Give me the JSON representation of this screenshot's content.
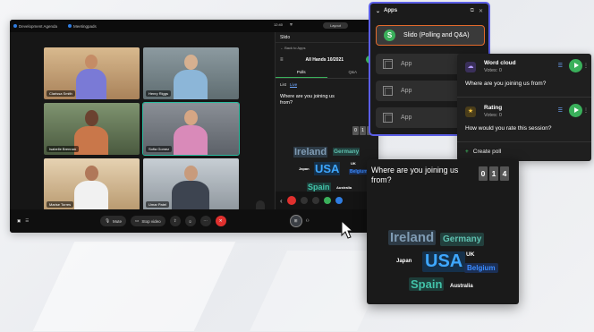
{
  "window_title_items": [
    "Development Agenda",
    "Meetingpads"
  ],
  "status_time": "12:40",
  "status_pill": "Layout",
  "participants": [
    {
      "name": "Clarissa Smith"
    },
    {
      "name": "Henry Riggs"
    },
    {
      "name": "Isabelle Brennan"
    },
    {
      "name": "Sofia Gomez"
    },
    {
      "name": "Marise Torres"
    },
    {
      "name": "Umar Patel"
    }
  ],
  "controls": {
    "mute": "Mute",
    "stop_video": "Stop video",
    "leave": "✕"
  },
  "slido_panel": {
    "header": "Slido",
    "back": "← Back to Apps",
    "event": "All Hands 10/2021",
    "tabs": [
      "Polls",
      "Q&A"
    ],
    "subtabs": [
      "List",
      "Live"
    ],
    "question": "Where are you joining us from?",
    "counter": [
      "0",
      "1",
      "4"
    ]
  },
  "apps_panel": {
    "title": "Apps",
    "items": [
      {
        "label": "Slido (Polling and Q&A)"
      },
      {
        "label": "App"
      },
      {
        "label": "App"
      },
      {
        "label": "App"
      }
    ]
  },
  "polls": [
    {
      "name": "Word cloud",
      "votes": "Votes: 0",
      "question": "Where are you joining us from?"
    },
    {
      "name": "Rating",
      "votes": "Votes: 0",
      "question": "How would you rate this session?"
    }
  ],
  "create_poll": "Create poll",
  "result": {
    "question": "Where are you joining us from?",
    "counter": [
      "0",
      "1",
      "4"
    ],
    "words": [
      {
        "text": "Ireland",
        "color": "#7f9bb3",
        "bg": "#2d3a45"
      },
      {
        "text": "Germany",
        "color": "#5fc1b0",
        "bg": "#22403d"
      },
      {
        "text": "Japan",
        "color": "#ffffff",
        "bg": "transparent"
      },
      {
        "text": "USA",
        "color": "#3ea7ff",
        "bg": "#15304a"
      },
      {
        "text": "UK",
        "color": "#ffffff",
        "bg": "transparent"
      },
      {
        "text": "Belgium",
        "color": "#3b8bff",
        "bg": "#1b2f55"
      },
      {
        "text": "Spain",
        "color": "#42c2a8",
        "bg": "#1d3d39"
      },
      {
        "text": "Australia",
        "color": "#ffffff",
        "bg": "transparent"
      }
    ]
  }
}
